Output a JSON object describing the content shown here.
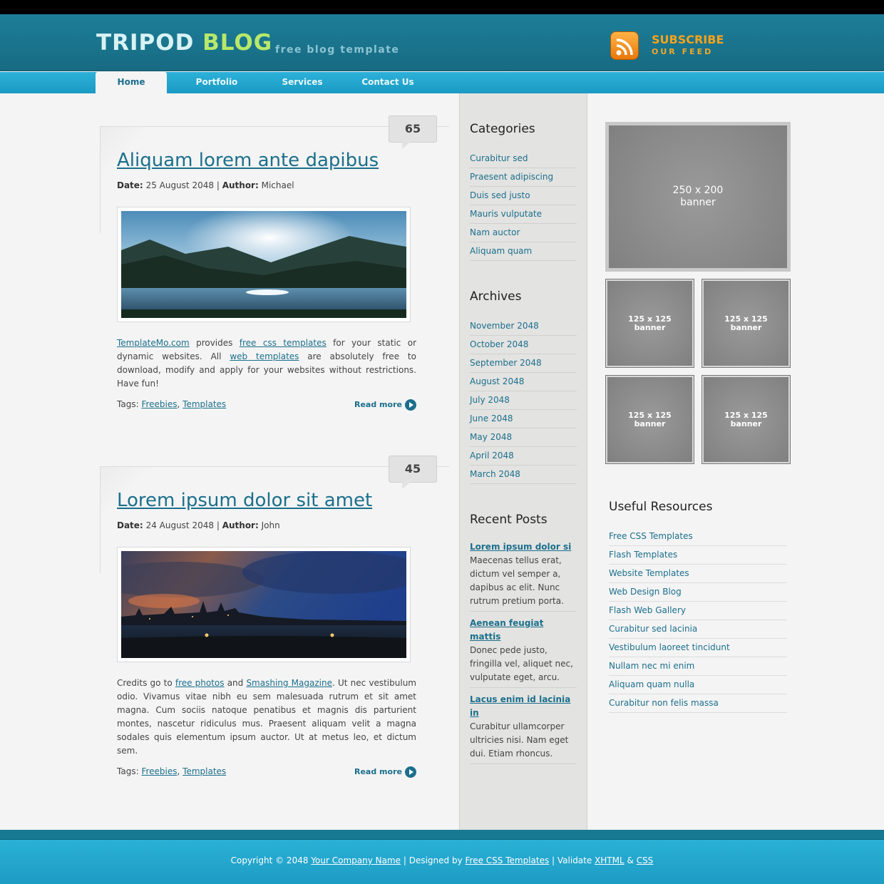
{
  "header": {
    "logo_part1": "TRIPOD",
    "logo_part2": "BLOG",
    "tagline": "free blog template",
    "subscribe_line1": "SUBSCRIBE",
    "subscribe_line2": "OUR FEED"
  },
  "nav": {
    "items": [
      {
        "label": "Home"
      },
      {
        "label": "Portfolio"
      },
      {
        "label": "Services"
      },
      {
        "label": "Contact Us"
      }
    ]
  },
  "posts": [
    {
      "comments": "65",
      "title": "Aliquam lorem ante dapibus",
      "date_label": "Date:",
      "date": "25 August 2048",
      "sep": "|",
      "author_label": "Author:",
      "author": "Michael",
      "text": {
        "link1": "TemplateMo.com",
        "t1": " provides ",
        "link2": "free css templates",
        "t2": " for your static or dynamic websites. All ",
        "link3": "web templates",
        "t3": " are absolutely free to download, modify and apply for your websites without restrictions. Have fun!"
      },
      "tags_label": "Tags:",
      "tag1": "Freebies",
      "tag_sep": ",",
      "tag2": "Templates",
      "read_more": "Read more"
    },
    {
      "comments": "45",
      "title": "Lorem ipsum dolor sit amet",
      "date_label": "Date:",
      "date": "24 August 2048",
      "sep": "|",
      "author_label": "Author:",
      "author": "John",
      "text": {
        "t0": "Credits go to ",
        "link1": "free photos",
        "t1": " and ",
        "link2": "Smashing Magazine",
        "t2": ". Ut nec vestibulum odio. Vivamus vitae nibh eu sem malesuada rutrum et sit amet magna. Cum sociis natoque penatibus et magnis dis parturient montes, nascetur ridiculus mus. Praesent aliquam velit a magna sodales quis elementum ipsum auctor. Ut at metus leo, et dictum sem."
      },
      "tags_label": "Tags:",
      "tag1": "Freebies",
      "tag_sep": ",",
      "tag2": "Templates",
      "read_more": "Read more"
    }
  ],
  "categories": {
    "title": "Categories",
    "items": [
      "Curabitur sed",
      "Praesent adipiscing",
      "Duis sed justo",
      "Mauris vulputate",
      "Nam auctor",
      "Aliquam quam"
    ]
  },
  "archives": {
    "title": "Archives",
    "items": [
      "November 2048",
      "October 2048",
      "September 2048",
      "August 2048",
      "July 2048",
      "June 2048",
      "May 2048",
      "April 2048",
      "March 2048"
    ]
  },
  "recent_posts": {
    "title": "Recent Posts",
    "items": [
      {
        "title": "Lorem ipsum dolor si",
        "desc": "Maecenas tellus erat, dictum vel semper a, dapibus ac elit. Nunc rutrum pretium porta."
      },
      {
        "title": "Aenean feugiat mattis",
        "desc": "Donec pede justo, fringilla vel, aliquet nec, vulputate eget, arcu."
      },
      {
        "title": "Lacus enim id lacinia in",
        "desc": "Curabitur ullamcorper ultricies nisi. Nam eget dui. Etiam rhoncus."
      }
    ]
  },
  "banners": {
    "large_line1": "250 x 200",
    "large_line2": "banner",
    "small_line1": "125 x 125",
    "small_line2": "banner"
  },
  "useful_resources": {
    "title": "Useful Resources",
    "items": [
      "Free CSS Templates",
      "Flash Templates",
      "Website Templates",
      "Web Design Blog",
      "Flash Web Gallery",
      "Curabitur sed lacinia",
      "Vestibulum laoreet tincidunt",
      "Nullam nec mi enim",
      "Aliquam quam nulla",
      "Curabitur non felis massa"
    ]
  },
  "footer": {
    "copyright": "Copyright © 2048 ",
    "company": "Your Company Name",
    "sep1": " | Designed by ",
    "designer": "Free CSS Templates",
    "sep2": " | Validate ",
    "xhtml": "XHTML",
    "amp": " & ",
    "css": "CSS"
  }
}
